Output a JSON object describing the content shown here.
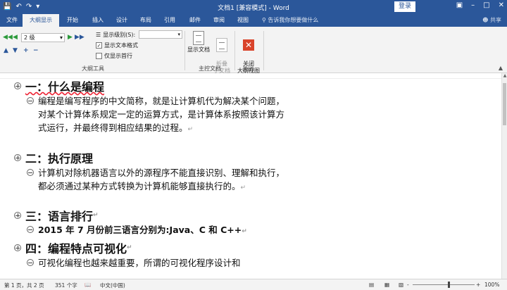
{
  "titlebar": {
    "title": "文档1 [兼容模式] - Word",
    "login": "登录",
    "qat_icons": [
      "save-icon",
      "undo-icon",
      "redo-icon",
      "customize-icon"
    ],
    "window_controls": [
      "ribbon-display-icon",
      "minimize-icon",
      "maximize-icon",
      "close-icon"
    ]
  },
  "tabs": [
    "文件",
    "大纲显示",
    "开始",
    "插入",
    "设计",
    "布局",
    "引用",
    "邮件",
    "审阅",
    "视图"
  ],
  "active_tab": "大纲显示",
  "tell_me": "告诉我你想要做什么",
  "share": "共享",
  "ribbon": {
    "level_value": "2 级",
    "show_level_label": "显示级别(S):",
    "show_level_value": "",
    "show_text_format": "显示文本格式",
    "show_text_format_checked": true,
    "show_first_line": "仅显示首行",
    "show_first_line_checked": false,
    "outline_tools_label": "大纲工具",
    "show_document": "显示文档",
    "collapse_subdoc": "折叠\n子文档",
    "master_doc_label": "主控文档",
    "close_outline": "关闭\n大纲视图",
    "close_label": "关闭"
  },
  "document": {
    "h1": "一：什么是编程",
    "p1": "编程是编写程序的中文简称，就是让计算机代为解决某个问题，对某个计算体系规定一定的运算方式，是计算体系按照该计算方式运行，并最终得到相应结果的过程。",
    "h2": "二：执行原理",
    "p2": "计算机对除机器语言以外的源程序不能直接识别、理解和执行，都必须通过某种方式转换为计算机能够直接执行的。",
    "h3": "三：语言排行",
    "p3": "2015 年 7 月份前三语言分别为:Java、C 和 C++",
    "h4": "四：编程特点可视化",
    "p4": "可视化编程也越来越重要，所谓的可视化程序设计和",
    "pilcrow": "↵"
  },
  "statusbar": {
    "page": "第 1 页，共 2 页",
    "words": "351 个字",
    "language": "中文(中国)",
    "zoom": "100%",
    "zoom_minus": "-",
    "zoom_plus": "+"
  },
  "colors": {
    "accent": "#2b579a",
    "ribbon_bg": "#f3f3f3",
    "close_red": "#d9442b"
  }
}
